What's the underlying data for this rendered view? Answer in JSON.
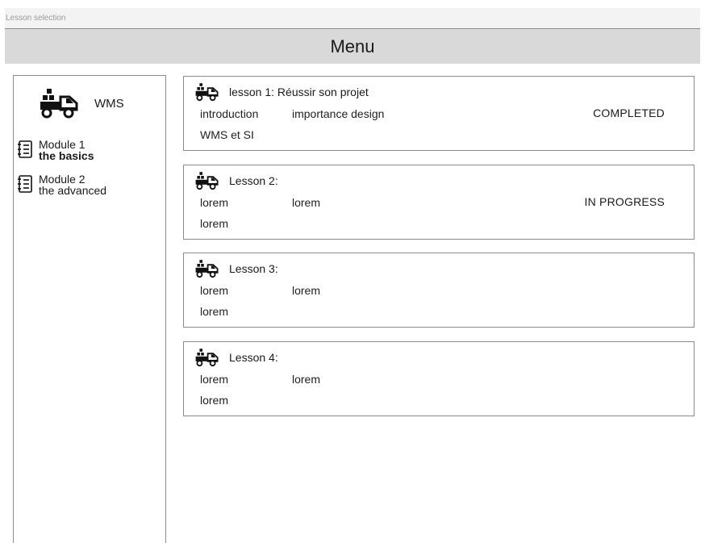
{
  "window": {
    "title": "Lesson selection"
  },
  "header": {
    "title": "Menu"
  },
  "sidebar": {
    "brand_label": "WMS",
    "modules": [
      {
        "title": "Module 1",
        "subtitle": "the basics",
        "active": true
      },
      {
        "title": "Module 2",
        "subtitle": "the advanced",
        "active": false
      }
    ]
  },
  "lessons": [
    {
      "title": "lesson 1: Réussir son projet",
      "items": [
        "introduction",
        "importance design",
        "WMS et SI"
      ],
      "status": "COMPLETED"
    },
    {
      "title": "Lesson 2:",
      "items": [
        "lorem",
        "lorem",
        "lorem"
      ],
      "status": "IN PROGRESS"
    },
    {
      "title": "Lesson 3:",
      "items": [
        "lorem",
        "lorem",
        "lorem"
      ],
      "status": ""
    },
    {
      "title": "Lesson 4:",
      "items": [
        "lorem",
        "lorem",
        "lorem"
      ],
      "status": ""
    }
  ],
  "icons": {
    "brand": "truck-icon",
    "lesson": "truck-icon",
    "module": "notebook-icon"
  }
}
